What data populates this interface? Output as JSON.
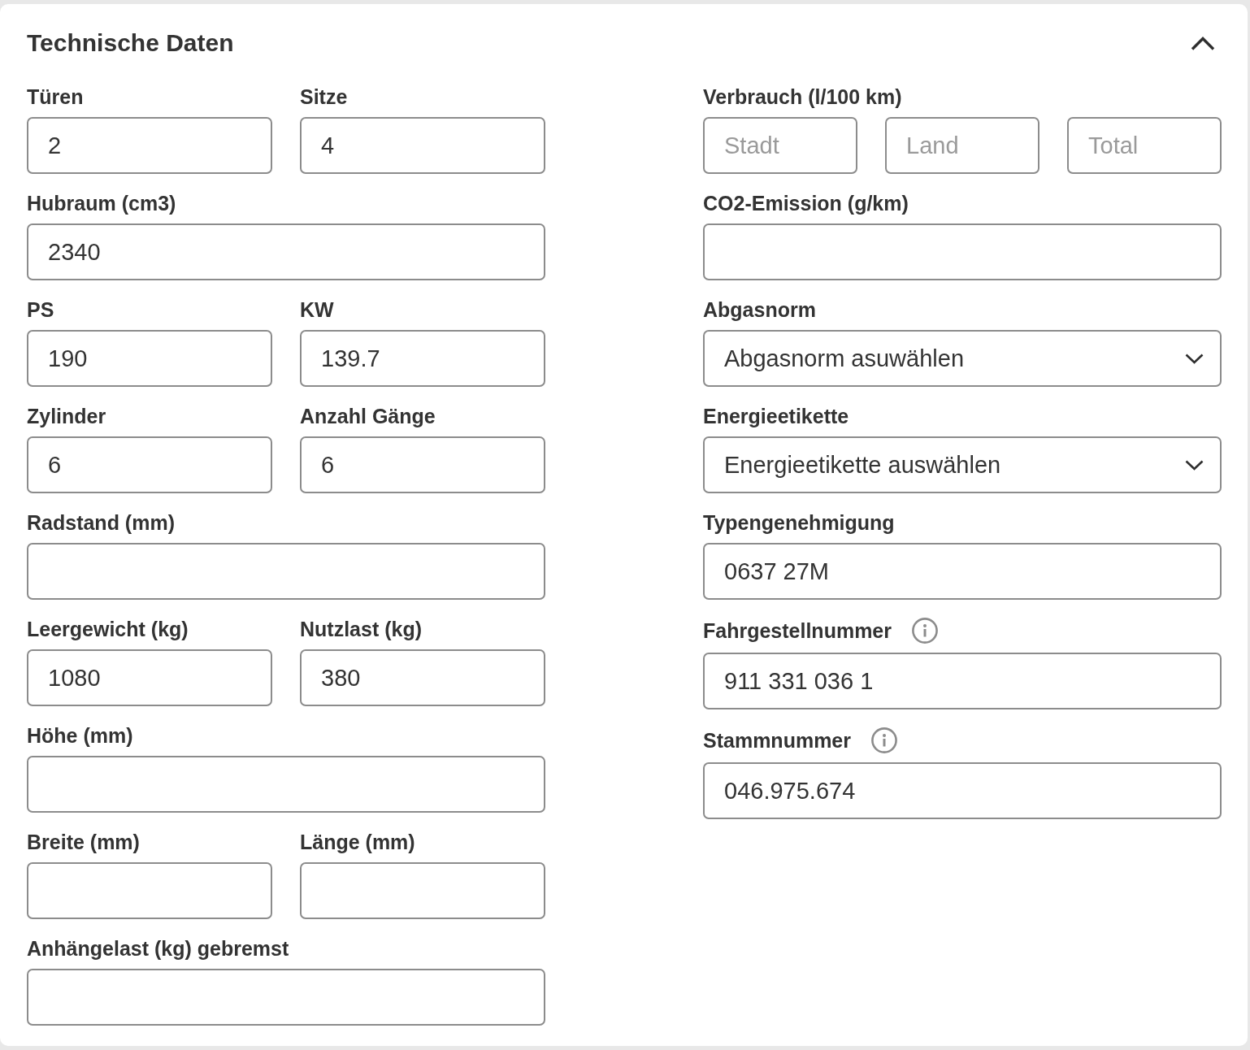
{
  "panel": {
    "title": "Technische Daten",
    "expanded": true
  },
  "columns": [
    {
      "rows": [
        {
          "fields": [
            {
              "label": "Türen",
              "kind": "text",
              "value": "2"
            },
            {
              "label": "Sitze",
              "kind": "text",
              "value": "4"
            }
          ]
        },
        {
          "fields": [
            {
              "label": "Hubraum (cm3)",
              "kind": "text",
              "value": "2340"
            }
          ]
        },
        {
          "fields": [
            {
              "label": "PS",
              "kind": "text",
              "value": "190"
            },
            {
              "label": "KW",
              "kind": "text",
              "value": "139.7"
            }
          ]
        },
        {
          "fields": [
            {
              "label": "Zylinder",
              "kind": "text",
              "value": "6"
            },
            {
              "label": "Anzahl Gänge",
              "kind": "text",
              "value": "6"
            }
          ]
        },
        {
          "fields": [
            {
              "label": "Radstand (mm)",
              "kind": "text"
            }
          ]
        },
        {
          "fields": [
            {
              "label": "Leergewicht (kg)",
              "kind": "text",
              "value": "1080"
            },
            {
              "label": "Nutzlast (kg)",
              "kind": "text",
              "value": "380"
            }
          ]
        },
        {
          "fields": [
            {
              "label": "Höhe (mm)",
              "kind": "text"
            }
          ]
        },
        {
          "fields": [
            {
              "label": "Breite (mm)",
              "kind": "text"
            },
            {
              "label": "Länge (mm)",
              "kind": "text"
            }
          ]
        },
        {
          "fields": [
            {
              "label": "Anhängelast (kg) gebremst",
              "kind": "text"
            }
          ]
        }
      ]
    },
    {
      "rows": [
        {
          "fields": [
            {
              "label": "Verbrauch (l/100 km)",
              "kind": "group",
              "info": false,
              "inputs": [
                {
                  "placeholder": "Stadt"
                },
                {
                  "placeholder": "Land"
                },
                {
                  "placeholder": "Total"
                }
              ]
            }
          ]
        },
        {
          "fields": [
            {
              "label": "CO2-Emission (g/km)",
              "kind": "text",
              "info": false
            }
          ]
        },
        {
          "fields": [
            {
              "label": "Abgasnorm",
              "kind": "select",
              "info": false,
              "value": "Abgasnorm asuwählen"
            }
          ]
        },
        {
          "fields": [
            {
              "label": "Energieetikette",
              "kind": "select",
              "info": false,
              "value": "Energieetikette auswählen"
            }
          ]
        },
        {
          "fields": [
            {
              "label": "Typengenehmigung",
              "kind": "text",
              "info": false,
              "value": "0637 27M"
            }
          ]
        },
        {
          "fields": [
            {
              "label": "Fahrgestellnummer",
              "kind": "text",
              "info": true,
              "value": "911 331 036 1"
            }
          ]
        },
        {
          "fields": [
            {
              "label": "Stammnummer",
              "kind": "text",
              "info": true,
              "value": "046.975.674"
            }
          ]
        }
      ]
    }
  ]
}
